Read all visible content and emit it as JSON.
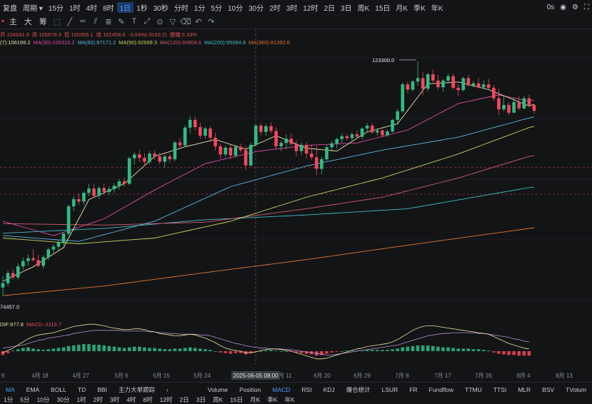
{
  "toolbar": {
    "left_label": "复盘",
    "period_label": "周期",
    "intervals": [
      "15分",
      "1时",
      "4时",
      "8时",
      "1日",
      "1秒",
      "30秒",
      "分时",
      "1分",
      "5分",
      "10分",
      "30分",
      "2时",
      "3时",
      "12时",
      "2日",
      "3日",
      "周K",
      "15日",
      "月K",
      "季K",
      "年K"
    ],
    "active_interval": "1日",
    "right_label": "0s"
  },
  "drawbar": {
    "labels": [
      "主",
      "大",
      "筹"
    ],
    "tools": [
      "pointer-tool",
      "line-tool",
      "hline-tool",
      "channel-tool",
      "fib-tool",
      "brush-tool",
      "text-tool",
      "measure-tool",
      "magnet-tool",
      "filter-tool",
      "delete-tool",
      "undo-tool",
      "redo-tool"
    ]
  },
  "info": {
    "ohlc": [
      "开 104641.8",
      "高 105878.3",
      "低 100305.1",
      "收 101458.6",
      "-3.04%(-3183.2)",
      "振幅 5.33%"
    ],
    "ma": [
      "(7):106199.2",
      "MA(30):105310.2",
      "MA(60):97171.2",
      "MA(90):92699.3",
      "MA(120):92804.6",
      "MA(200):95084.8",
      "MA(360):81392.6"
    ],
    "macd": [
      "DIF:977.8",
      "MACD:-2119.7"
    ]
  },
  "colors": {
    "up": "#2ebd85",
    "down": "#f6465d",
    "ma7": "#e7e4a8",
    "ma30": "#d84da6",
    "ma60": "#5ab7e0",
    "ma90": "#c2d55e",
    "ma120": "#d05d6e",
    "ma200": "#41b9c8",
    "ma360": "#e0762f",
    "dif": "#e6e0a0",
    "dea": "#b58ecf"
  },
  "chart_data": {
    "type": "candlestick",
    "annotations": {
      "high_label": "123300.0",
      "low_label": "74457.0",
      "high": 123300.0,
      "low": 74457.0
    },
    "last_price": 101458.6,
    "x_tick_labels": [
      "9",
      "4月 18",
      "4月 27",
      "5月 6",
      "5月 15",
      "5月 24",
      "6月 2",
      "6月 11",
      "6月 20",
      "6月 29",
      "7月 8",
      "7月 17",
      "7月 26",
      "8月 4",
      "8月 13"
    ],
    "crosshair_label": "2025-06-05 08:00",
    "ohlc": [
      [
        76200,
        78500,
        74457,
        77100
      ],
      [
        77100,
        79800,
        76400,
        79200
      ],
      [
        79200,
        80100,
        77800,
        78300
      ],
      [
        78300,
        81200,
        77900,
        80600
      ],
      [
        80600,
        82400,
        79900,
        81700
      ],
      [
        81700,
        83100,
        80800,
        82300
      ],
      [
        82300,
        84200,
        81600,
        81900
      ],
      [
        81900,
        83000,
        80400,
        80700
      ],
      [
        80700,
        82900,
        80100,
        82500
      ],
      [
        82500,
        84500,
        81900,
        84100
      ],
      [
        84100,
        85300,
        83200,
        84700
      ],
      [
        84700,
        86100,
        83900,
        85600
      ],
      [
        85600,
        87800,
        84900,
        87400
      ],
      [
        87400,
        93500,
        87000,
        93100
      ],
      [
        93100,
        95200,
        92100,
        94600
      ],
      [
        94600,
        95800,
        93400,
        94100
      ],
      [
        94100,
        96200,
        93500,
        95900
      ],
      [
        95900,
        97800,
        95200,
        96800
      ],
      [
        96800,
        97700,
        94900,
        95300
      ],
      [
        95300,
        97300,
        94600,
        96900
      ],
      [
        96900,
        97800,
        95600,
        96100
      ],
      [
        96100,
        97300,
        95400,
        96700
      ],
      [
        96700,
        97900,
        95900,
        97400
      ],
      [
        97400,
        98800,
        96600,
        98300
      ],
      [
        98300,
        99100,
        97200,
        97800
      ],
      [
        97800,
        103500,
        97500,
        103100
      ],
      [
        103100,
        104300,
        101800,
        103900
      ],
      [
        103900,
        104800,
        102300,
        103200
      ],
      [
        103200,
        104100,
        101600,
        102400
      ],
      [
        102400,
        104600,
        101900,
        104100
      ],
      [
        104100,
        104800,
        102800,
        103500
      ],
      [
        103500,
        104300,
        101900,
        102400
      ],
      [
        102400,
        103900,
        101100,
        103500
      ],
      [
        103500,
        104200,
        102200,
        102900
      ],
      [
        102900,
        106700,
        102500,
        106400
      ],
      [
        106400,
        107300,
        105200,
        105800
      ],
      [
        105800,
        109900,
        105500,
        109500
      ],
      [
        109500,
        111900,
        108400,
        111100
      ],
      [
        111100,
        111800,
        108900,
        109600
      ],
      [
        109600,
        110500,
        107100,
        107800
      ],
      [
        107800,
        109700,
        107200,
        109300
      ],
      [
        109300,
        109900,
        106600,
        107400
      ],
      [
        107400,
        108400,
        104700,
        105600
      ],
      [
        105600,
        106200,
        103100,
        103900
      ],
      [
        103900,
        105700,
        103300,
        105300
      ],
      [
        105300,
        106000,
        102900,
        103700
      ],
      [
        103700,
        105900,
        103200,
        105500
      ],
      [
        105500,
        106200,
        104300,
        104800
      ],
      [
        104800,
        105700,
        100600,
        101600
      ],
      [
        101600,
        106300,
        101400,
        105900
      ],
      [
        105900,
        110300,
        105600,
        109900
      ],
      [
        109900,
        110400,
        107900,
        108600
      ],
      [
        108600,
        110200,
        107800,
        109800
      ],
      [
        109800,
        110600,
        108300,
        108800
      ],
      [
        108800,
        109500,
        104900,
        105600
      ],
      [
        105600,
        106800,
        104600,
        106300
      ],
      [
        106300,
        108100,
        104900,
        107200
      ],
      [
        107200,
        108300,
        105800,
        106100
      ],
      [
        106100,
        106900,
        103500,
        104600
      ],
      [
        104600,
        106400,
        103800,
        105900
      ],
      [
        105900,
        106500,
        103000,
        104100
      ],
      [
        104100,
        106000,
        102800,
        103300
      ],
      [
        103300,
        105600,
        99600,
        100900
      ],
      [
        100900,
        103500,
        99800,
        102900
      ],
      [
        102900,
        105900,
        102600,
        105400
      ],
      [
        105400,
        106700,
        104700,
        106200
      ],
      [
        106200,
        107400,
        105200,
        107100
      ],
      [
        107100,
        108300,
        106300,
        107700
      ],
      [
        107700,
        108200,
        106800,
        107300
      ],
      [
        107300,
        108500,
        106600,
        108100
      ],
      [
        108100,
        108900,
        107100,
        107600
      ],
      [
        107600,
        109600,
        107100,
        109300
      ],
      [
        109300,
        110500,
        108600,
        109900
      ],
      [
        109900,
        110400,
        108200,
        108500
      ],
      [
        108500,
        109400,
        107800,
        108900
      ],
      [
        108900,
        109200,
        107400,
        107900
      ],
      [
        107900,
        109100,
        107500,
        108700
      ],
      [
        108700,
        111300,
        108400,
        111100
      ],
      [
        111100,
        113400,
        110500,
        112900
      ],
      [
        112900,
        118900,
        112500,
        118500
      ],
      [
        118500,
        119100,
        116600,
        117400
      ],
      [
        117400,
        119400,
        117100,
        119100
      ],
      [
        119100,
        123300,
        118200,
        119800
      ],
      [
        119800,
        121100,
        116200,
        117600
      ],
      [
        117600,
        120900,
        117100,
        120600
      ],
      [
        120600,
        121600,
        118900,
        119300
      ],
      [
        119300,
        120500,
        117400,
        117900
      ],
      [
        117900,
        119600,
        116900,
        119300
      ],
      [
        119300,
        120800,
        118600,
        120200
      ],
      [
        120200,
        120700,
        117500,
        117800
      ],
      [
        117800,
        118500,
        116100,
        117300
      ],
      [
        117300,
        120000,
        117000,
        119800
      ],
      [
        119800,
        120400,
        118000,
        118300
      ],
      [
        118300,
        119200,
        117800,
        118700
      ],
      [
        118700,
        119800,
        117600,
        117900
      ],
      [
        117900,
        119300,
        117700,
        118500
      ],
      [
        118500,
        119600,
        117400,
        117800
      ],
      [
        117800,
        118400,
        115000,
        115600
      ],
      [
        115600,
        117600,
        112100,
        113300
      ],
      [
        113300,
        115900,
        112900,
        114200
      ],
      [
        114200,
        114800,
        112000,
        112600
      ],
      [
        112600,
        115800,
        112500,
        114800
      ],
      [
        114800,
        116000,
        113100,
        113500
      ],
      [
        113500,
        116100,
        113300,
        115600
      ],
      [
        115600,
        116300,
        113700,
        114200
      ],
      [
        114200,
        114400,
        112400,
        113000
      ]
    ],
    "ma_series": [
      {
        "name": "MA(7)",
        "key": "ma7",
        "points": [
          [
            0,
            77500
          ],
          [
            6,
            80500
          ],
          [
            12,
            84500
          ],
          [
            17,
            94500
          ],
          [
            24,
            97800
          ],
          [
            30,
            103500
          ],
          [
            36,
            105500
          ],
          [
            42,
            107000
          ],
          [
            48,
            105000
          ],
          [
            54,
            107800
          ],
          [
            60,
            105200
          ],
          [
            66,
            104600
          ],
          [
            72,
            108600
          ],
          [
            78,
            110300
          ],
          [
            84,
            118600
          ],
          [
            90,
            119000
          ],
          [
            96,
            117400
          ],
          [
            104,
            114000
          ]
        ]
      },
      {
        "name": "MA(30)",
        "key": "ma30",
        "points": [
          [
            0,
            90000
          ],
          [
            10,
            87000
          ],
          [
            20,
            90500
          ],
          [
            30,
            96500
          ],
          [
            40,
            102000
          ],
          [
            50,
            104500
          ],
          [
            60,
            105800
          ],
          [
            70,
            106300
          ],
          [
            80,
            109000
          ],
          [
            90,
            114500
          ],
          [
            98,
            116300
          ],
          [
            104,
            115000
          ]
        ]
      },
      {
        "name": "MA(60)",
        "key": "ma60",
        "points": [
          [
            0,
            87000
          ],
          [
            15,
            85800
          ],
          [
            30,
            90000
          ],
          [
            45,
            97200
          ],
          [
            60,
            101500
          ],
          [
            75,
            104800
          ],
          [
            90,
            107500
          ],
          [
            104,
            111500
          ]
        ]
      },
      {
        "name": "MA(90)",
        "key": "ma90",
        "points": [
          [
            0,
            86500
          ],
          [
            15,
            85300
          ],
          [
            30,
            86500
          ],
          [
            45,
            90000
          ],
          [
            60,
            95000
          ],
          [
            75,
            99000
          ],
          [
            90,
            104000
          ],
          [
            104,
            109500
          ]
        ]
      },
      {
        "name": "MA(120)",
        "key": "ma120",
        "points": [
          [
            0,
            89500
          ],
          [
            20,
            89200
          ],
          [
            40,
            89800
          ],
          [
            60,
            92600
          ],
          [
            75,
            95000
          ],
          [
            90,
            99000
          ],
          [
            104,
            103500
          ]
        ]
      },
      {
        "name": "MA(200)",
        "key": "ma200",
        "points": [
          [
            0,
            87500
          ],
          [
            20,
            88500
          ],
          [
            40,
            90300
          ],
          [
            60,
            91300
          ],
          [
            80,
            92600
          ],
          [
            104,
            97000
          ]
        ]
      },
      {
        "name": "MA(360)",
        "key": "ma360",
        "points": [
          [
            0,
            74500
          ],
          [
            20,
            76500
          ],
          [
            40,
            79300
          ],
          [
            60,
            82000
          ],
          [
            80,
            85000
          ],
          [
            104,
            88500
          ]
        ]
      }
    ],
    "macd": {
      "hist": [
        -0.6,
        -0.3,
        0.1,
        0.3,
        0.5,
        0.6,
        0.4,
        0.3,
        0.2,
        0.3,
        0.4,
        0.5,
        0.6,
        0.8,
        0.9,
        1.0,
        1.1,
        1.1,
        1.0,
        1.0,
        0.9,
        0.8,
        0.7,
        0.6,
        0.5,
        0.6,
        0.7,
        0.7,
        0.6,
        0.5,
        0.5,
        0.4,
        0.3,
        0.3,
        0.4,
        0.4,
        0.5,
        0.6,
        0.5,
        0.4,
        0.3,
        0.2,
        0.0,
        -0.2,
        -0.3,
        -0.4,
        -0.3,
        -0.3,
        -0.5,
        -0.3,
        -0.1,
        0.0,
        0.1,
        0.2,
        0.1,
        0.0,
        0.0,
        -0.1,
        -0.2,
        -0.3,
        -0.4,
        -0.5,
        -0.7,
        -0.6,
        -0.4,
        -0.2,
        -0.1,
        0.0,
        0.1,
        0.1,
        0.1,
        0.1,
        0.2,
        0.2,
        0.2,
        0.2,
        0.2,
        0.3,
        0.4,
        0.6,
        0.7,
        0.8,
        0.9,
        0.9,
        0.9,
        0.8,
        0.7,
        0.6,
        0.6,
        0.5,
        0.4,
        0.4,
        0.4,
        0.3,
        0.3,
        0.2,
        0.1,
        -0.2,
        -0.4,
        -0.5,
        -0.6,
        -0.6,
        -0.7,
        -0.7,
        -0.7
      ],
      "dif": [
        -0.2,
        0.1,
        0.4,
        0.8,
        1.2,
        1.6,
        1.9,
        2.1,
        2.2,
        2.3,
        2.4,
        2.6,
        2.8,
        3.0,
        3.2,
        3.3,
        3.4,
        3.5,
        3.5,
        3.4,
        3.3,
        3.1,
        3.0,
        2.9,
        2.8,
        2.8,
        2.9,
        2.9,
        2.8,
        2.6,
        2.5,
        2.3,
        2.2,
        2.1,
        2.0,
        2.0,
        2.1,
        2.2,
        2.1,
        1.9,
        1.7,
        1.4,
        1.1,
        0.7,
        0.4,
        0.2,
        0.1,
        0.0,
        -0.2,
        -0.2,
        -0.1,
        0.1,
        0.2,
        0.3,
        0.3,
        0.2,
        0.1,
        0.0,
        -0.2,
        -0.4,
        -0.6,
        -0.8,
        -1.0,
        -1.0,
        -0.9,
        -0.7,
        -0.5,
        -0.3,
        -0.1,
        0.1,
        0.3,
        0.4,
        0.6,
        0.7,
        0.8,
        0.9,
        1.0,
        1.2,
        1.5,
        1.9,
        2.3,
        2.7,
        3.0,
        3.2,
        3.3,
        3.3,
        3.2,
        3.1,
        3.0,
        2.9,
        2.8,
        2.7,
        2.6,
        2.5,
        2.4,
        2.3,
        2.2,
        1.9,
        1.6,
        1.3,
        1.0,
        0.8,
        0.6,
        0.4,
        0.3
      ],
      "dea": [
        0.4,
        0.5,
        0.6,
        0.7,
        0.8,
        1.0,
        1.2,
        1.4,
        1.5,
        1.7,
        1.8,
        1.9,
        2.0,
        2.1,
        2.3,
        2.4,
        2.5,
        2.6,
        2.7,
        2.7,
        2.7,
        2.7,
        2.7,
        2.7,
        2.6,
        2.6,
        2.6,
        2.6,
        2.6,
        2.5,
        2.5,
        2.4,
        2.4,
        2.3,
        2.3,
        2.2,
        2.2,
        2.2,
        2.2,
        2.1,
        2.1,
        2.0,
        1.8,
        1.6,
        1.4,
        1.2,
        1.0,
        0.9,
        0.7,
        0.6,
        0.5,
        0.4,
        0.4,
        0.3,
        0.3,
        0.3,
        0.2,
        0.2,
        0.1,
        0.0,
        -0.1,
        -0.2,
        -0.3,
        -0.4,
        -0.5,
        -0.5,
        -0.4,
        -0.3,
        -0.2,
        -0.1,
        0.0,
        0.1,
        0.2,
        0.3,
        0.4,
        0.5,
        0.6,
        0.7,
        0.8,
        1.0,
        1.2,
        1.4,
        1.6,
        1.8,
        2.0,
        2.1,
        2.2,
        2.3,
        2.3,
        2.4,
        2.4,
        2.4,
        2.4,
        2.4,
        2.3,
        2.3,
        2.2,
        2.1,
        2.0,
        1.9,
        1.8,
        1.6,
        1.5,
        1.3,
        1.2
      ]
    },
    "bottom_tabs": [
      "MA",
      "EMA",
      "BOLL",
      "TD",
      "BBI",
      "主力大单跟踪",
      "Volume",
      "Position",
      "MACD",
      "RSI",
      "KDJ",
      "爆仓统计",
      "LSUR",
      "FR",
      "Fundflow",
      "TTMU",
      "TTSI",
      "MLR",
      "BSV",
      "TVolum"
    ],
    "active_main_tab": "MA",
    "active_sub_tab": "MACD",
    "footer_intervals": [
      "1分",
      "5分",
      "10分",
      "30分",
      "1时",
      "2时",
      "3时",
      "4时",
      "8时",
      "12时",
      "2日",
      "3日",
      "周K",
      "15日",
      "月K",
      "季K",
      "年K"
    ]
  }
}
